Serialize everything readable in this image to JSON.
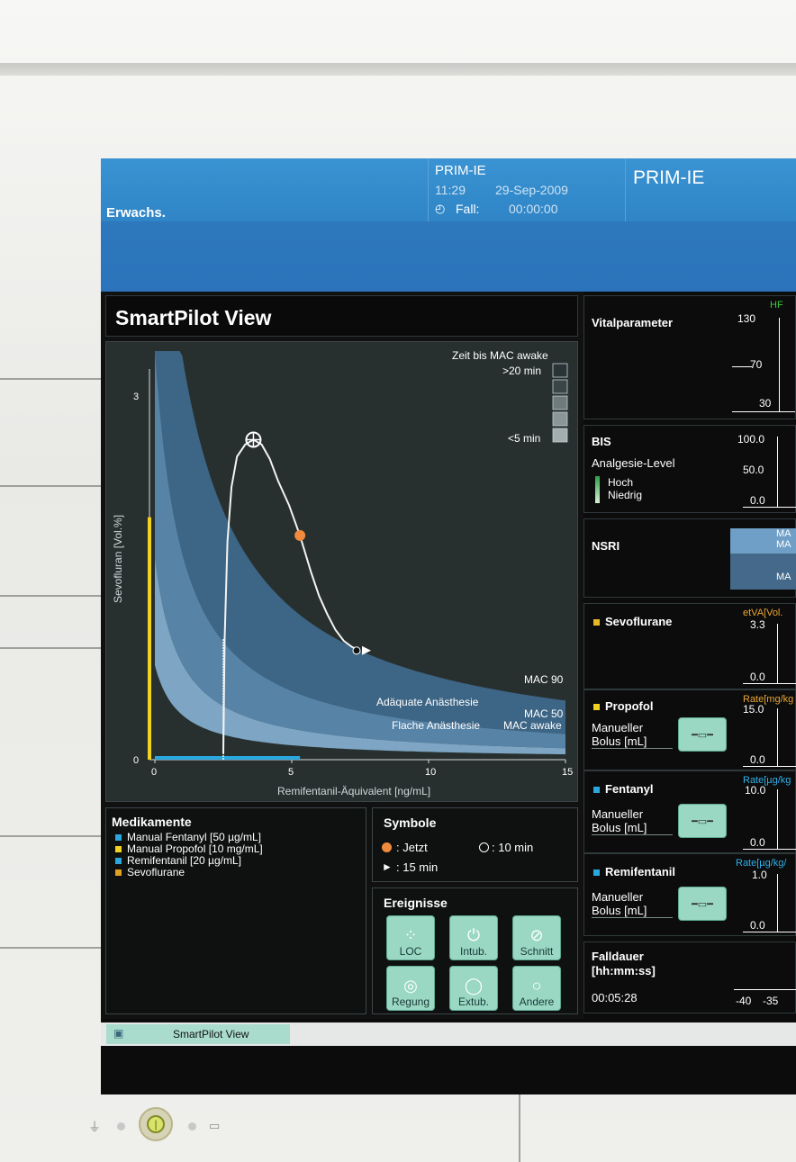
{
  "header": {
    "patient_type": "Erwachs.",
    "bed_name": "PRIM-IE",
    "time": "11:29",
    "date": "29-Sep-2009",
    "case_label": "Fall:",
    "case_time": "00:00:00",
    "bed_name_large": "PRIM-IE"
  },
  "smartpilot": {
    "title": "SmartPilot View",
    "time_to_mac_awake_title": "Zeit bis MAC awake",
    "legend_top": ">20 min",
    "legend_bottom": "<5 min",
    "ylabel": "Sevofluran [Vol.%]",
    "xlabel": "Remifentanil-Äquivalent [ng/mL]",
    "y_ticks": [
      "3",
      "0"
    ],
    "x_ticks": [
      "0",
      "5",
      "10",
      "15"
    ],
    "band_labels": {
      "mac90": "MAC 90",
      "adequate": "Adäquate Anästhesie",
      "mac50": "MAC 50",
      "shallow": "Flache Anästhesie",
      "mac_awake": "MAC awake"
    }
  },
  "chart_data": {
    "type": "line",
    "xlabel": "Remifentanil-Äquivalent [ng/mL]",
    "ylabel": "Sevofluran [Vol.%]",
    "xlim": [
      0,
      15
    ],
    "ylim": [
      0,
      3
    ],
    "series": [
      {
        "name": "",
        "x": [
          2.5,
          2.55,
          2.65,
          2.8,
          3.0,
          3.3,
          3.6,
          3.9,
          4.2,
          4.5,
          4.9,
          5.3,
          5.7,
          6.0,
          6.3,
          6.6,
          6.9,
          7.2,
          7.5
        ],
        "y": [
          0.05,
          1.0,
          1.8,
          2.25,
          2.5,
          2.6,
          2.64,
          2.6,
          2.48,
          2.3,
          2.1,
          1.85,
          1.55,
          1.35,
          1.2,
          1.07,
          0.98,
          0.93,
          0.9
        ]
      }
    ],
    "markers": {
      "jetzt": {
        "x": 5.3,
        "y": 1.85
      },
      "ten_min": {
        "x": 3.6,
        "y": 2.64
      },
      "fifteen_min": {
        "x": 7.5,
        "y": 0.9
      }
    },
    "bars": {
      "sevoflurane_y": 2.0,
      "remifentanil_x": [
        0,
        5.3
      ]
    }
  },
  "medikamente": {
    "title": "Medikamente",
    "items": [
      {
        "label": "Manual Fentanyl  [50 µg/mL]",
        "color": "#29a8e0"
      },
      {
        "label": "Manual Propofol  [10 mg/mL]",
        "color": "#f1d21f"
      },
      {
        "label": "Remifentanil  [20 µg/mL]",
        "color": "#29a8e0"
      },
      {
        "label": "Sevoflurane",
        "color": "#e0a020"
      }
    ]
  },
  "symbole": {
    "title": "Symbole",
    "jetzt": ": Jetzt",
    "ten_min": ": 10 min",
    "fifteen_min": ": 15 min"
  },
  "ereignisse": {
    "title": "Ereignisse",
    "buttons": [
      "LOC",
      "Intub.",
      "Schnitt",
      "Regung",
      "Extub.",
      "Andere"
    ]
  },
  "vital": {
    "title": "Vitalparameter",
    "hf_label": "HF",
    "ticks": [
      "130",
      "70",
      "30"
    ]
  },
  "bis": {
    "title": "BIS",
    "analgesie": "Analgesie-Level",
    "hoch": "Hoch",
    "niedrig": "Niedrig",
    "ticks": [
      "100.0",
      "50.0",
      "0.0"
    ]
  },
  "nsri": {
    "title": "NSRI",
    "labels": [
      "MA",
      "MA",
      "MA"
    ]
  },
  "sevoflurane": {
    "title": "Sevoflurane",
    "unit": "etVA[Vol.",
    "top": "3.3",
    "bottom": "0.0"
  },
  "propofol": {
    "title": "Propofol",
    "unit": "Rate[mg/kg",
    "top": "15.0",
    "bottom": "0.0",
    "bolus": "Manueller Bolus [mL]"
  },
  "fentanyl": {
    "title": "Fentanyl",
    "unit": "Rate[µg/kg",
    "top": "10.0",
    "bottom": "0.0",
    "bolus": "Manueller Bolus [mL]"
  },
  "remifentanil": {
    "title": "Remifentanil",
    "unit": "Rate[µg/kg/",
    "top": "1.0",
    "bottom": "0.0",
    "bolus": "Manueller Bolus [mL]"
  },
  "falldauer": {
    "title": "Falldauer",
    "unit": "[hh:mm:ss]",
    "value": "00:05:28",
    "ticks": [
      "-40",
      "-35"
    ]
  },
  "taskbar": {
    "tab": "SmartPilot View"
  },
  "colors": {
    "header": "#2e7cc2",
    "teal_button": "#9ad8c4",
    "accent_orange": "#f08a3c"
  }
}
